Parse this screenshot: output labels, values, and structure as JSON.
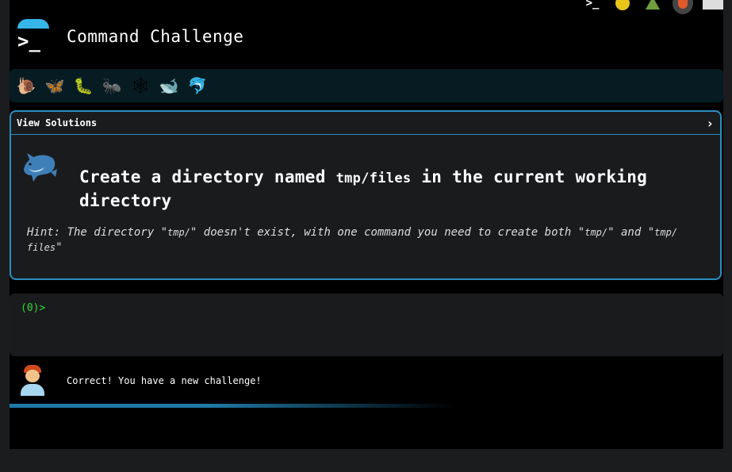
{
  "app": {
    "title": "Command Challenge"
  },
  "top_icons": [
    "terminal-icon",
    "lightbulb-icon",
    "tree-icon",
    "shield-icon",
    "mail-icon"
  ],
  "levels": [
    {
      "icon": "snail-icon",
      "glyph": "🐌"
    },
    {
      "icon": "butterfly-icon",
      "glyph": "🦋"
    },
    {
      "icon": "caterpillar-icon",
      "glyph": "🐛"
    },
    {
      "icon": "ant-icon",
      "glyph": "🐜"
    },
    {
      "icon": "spider-web-icon",
      "glyph": "🕸"
    },
    {
      "icon": "whale-icon",
      "glyph": "🐋"
    },
    {
      "icon": "dolphin-icon",
      "glyph": "🐬"
    }
  ],
  "card": {
    "header_label": "View Solutions",
    "chevron": "›",
    "title_pre": "Create a directory named ",
    "title_code": "tmp/files",
    "title_post": " in the current working directory",
    "hint_pre": "Hint: The directory \"",
    "hint_code1": "tmp/",
    "hint_mid": "\" doesn't exist, with one command you need to create both \"",
    "hint_code2": "tmp/",
    "hint_and": "\" and \"",
    "hint_code3": "tmp/\nfiles",
    "hint_end": "\""
  },
  "terminal": {
    "prompt": "(0)>"
  },
  "message": {
    "text": "Correct! You have a new challenge!"
  },
  "colors": {
    "accent": "#2a8fc0",
    "prompt_green": "#30d82f",
    "logo_blue": "#36b5e9"
  }
}
